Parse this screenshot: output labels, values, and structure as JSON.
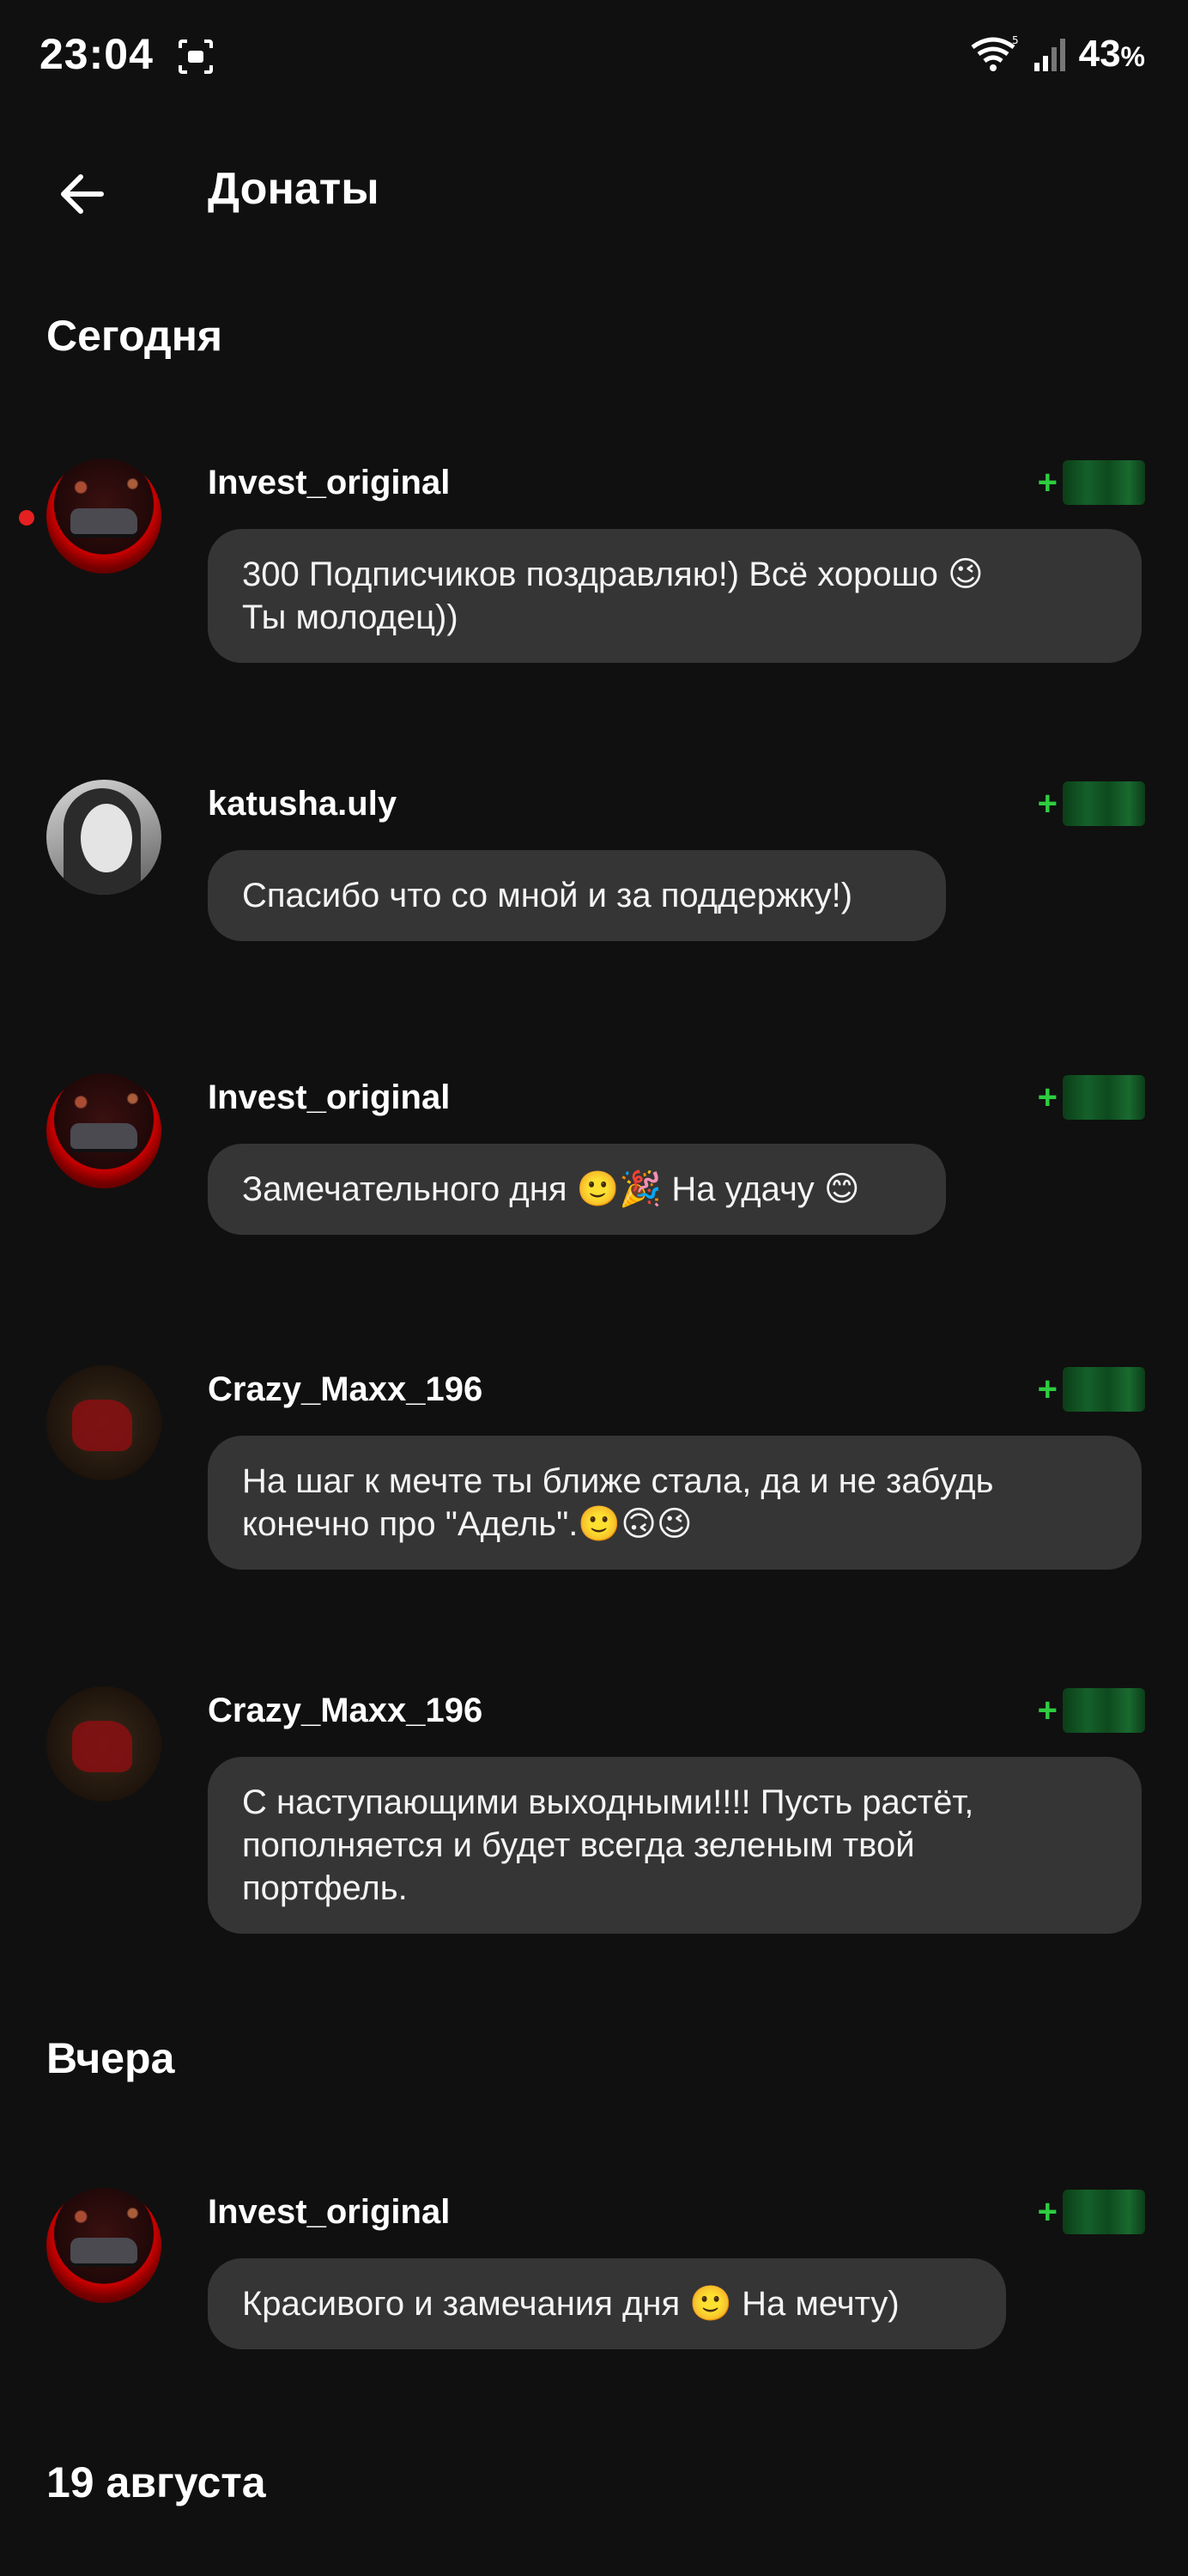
{
  "status_bar": {
    "time": "23:04",
    "battery": "43",
    "battery_unit": "%",
    "icons": [
      "screenshot-icon",
      "wifi-icon",
      "signal-icon"
    ]
  },
  "app_bar": {
    "back_icon": "arrow-left-icon",
    "title": "Донаты"
  },
  "sections": {
    "today": "Сегодня",
    "yesterday": "Вчера",
    "aug19": "19 августа"
  },
  "donations": [
    {
      "name": "Invest_original",
      "amount_sign": "+",
      "message": "300 Подписчиков поздравляю!) Всё хорошо 😉\nТы молодец))",
      "unread": true
    },
    {
      "name": "katusha.uly",
      "amount_sign": "+",
      "message": "Спасибо что со мной и за поддержку!)"
    },
    {
      "name": "Invest_original",
      "amount_sign": "+",
      "message": "Замечательного дня 🙂🎉 На удачу 😊"
    },
    {
      "name": "Crazy_Maxx_196",
      "amount_sign": "+",
      "message": "На шаг к мечте ты ближе стала, да и не забудь\nконечно про \"Адель\".🙂🙃😉"
    },
    {
      "name": "Crazy_Maxx_196",
      "amount_sign": "+",
      "message": "С наступающими выходными!!!! Пусть растёт,\nпополняется и будет всегда зеленым твой\nпортфель."
    },
    {
      "name": "Invest_original",
      "amount_sign": "+",
      "message": "Красивого и замечания дня 🙂  На мечту)"
    }
  ],
  "colors": {
    "background": "#101010",
    "bubble": "#353535",
    "amount_green": "#2ecc40",
    "unread_dot": "#e52020"
  }
}
